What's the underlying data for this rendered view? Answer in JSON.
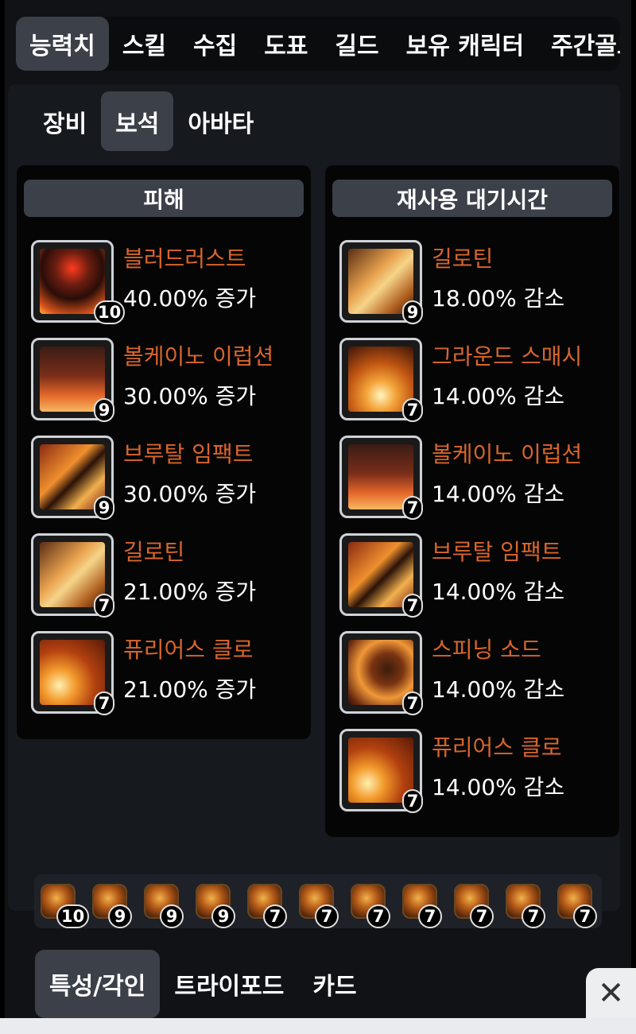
{
  "top_tabs": [
    "능력치",
    "스킬",
    "수집",
    "도표",
    "길드",
    "보유 캐릭터",
    "주간골드"
  ],
  "sub_tabs": [
    "장비",
    "보석",
    "아바타"
  ],
  "damage": {
    "header": "피해",
    "entries": [
      {
        "name": "블러드러스트",
        "value": "40.00% 증가",
        "level": "10",
        "icon": "bloodlust-skill-icon"
      },
      {
        "name": "볼케이노 이럽션",
        "value": "30.00% 증가",
        "level": "9",
        "icon": "volcano-eruption-skill-icon"
      },
      {
        "name": "브루탈 임팩트",
        "value": "30.00% 증가",
        "level": "9",
        "icon": "brutal-impact-skill-icon"
      },
      {
        "name": "길로틴",
        "value": "21.00% 증가",
        "level": "7",
        "icon": "guillotine-skill-icon"
      },
      {
        "name": "퓨리어스 클로",
        "value": "21.00% 증가",
        "level": "7",
        "icon": "furious-claw-skill-icon"
      }
    ]
  },
  "cooldown": {
    "header": "재사용 대기시간",
    "entries": [
      {
        "name": "길로틴",
        "value": "18.00% 감소",
        "level": "9",
        "icon": "guillotine-skill-icon"
      },
      {
        "name": "그라운드 스매시",
        "value": "14.00% 감소",
        "level": "7",
        "icon": "ground-smash-skill-icon"
      },
      {
        "name": "볼케이노 이럽션",
        "value": "14.00% 감소",
        "level": "7",
        "icon": "volcano-eruption-skill-icon"
      },
      {
        "name": "브루탈 임팩트",
        "value": "14.00% 감소",
        "level": "7",
        "icon": "brutal-impact-skill-icon"
      },
      {
        "name": "스피닝 소드",
        "value": "14.00% 감소",
        "level": "7",
        "icon": "spinning-sword-skill-icon"
      },
      {
        "name": "퓨리어스 클로",
        "value": "14.00% 감소",
        "level": "7",
        "icon": "furious-claw-skill-icon"
      }
    ]
  },
  "gems": [
    "10",
    "9",
    "9",
    "9",
    "7",
    "7",
    "7",
    "7",
    "7",
    "7",
    "7"
  ],
  "bottom_tabs": [
    "특성/각인",
    "트라이포드",
    "카드"
  ],
  "close_icon": "close-icon",
  "colors": {
    "skill_name": "#d8652b",
    "active_tab": "#3b4049",
    "panel": "#16191e"
  }
}
